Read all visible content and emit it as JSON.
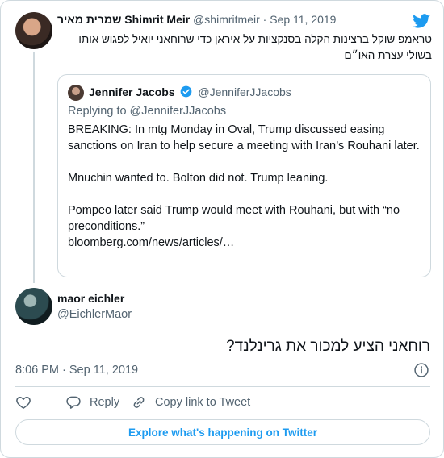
{
  "colors": {
    "brand": "#1d9bf0",
    "muted": "#536471",
    "text": "#0f1419",
    "border": "#cfd9de"
  },
  "original_tweet": {
    "author_name": "שמרית מאיר Shimrit Meir",
    "handle": "@shimritmeir",
    "date": "Sep 11, 2019",
    "text": "טראמפ שוקל ברצינות הקלה בסנקציות על איראן כדי שרוחאני יואיל לפגוש אותו בשולי עצרת האו״ם"
  },
  "quoted_tweet": {
    "author_name": "Jennifer Jacobs",
    "verified": true,
    "handle": "@JenniferJJacobs",
    "replying_to": "Replying to @JenniferJJacobs",
    "paragraphs": [
      "BREAKING: In mtg Monday in Oval, Trump discussed easing sanctions on Iran to help secure a meeting with Iran’s Rouhani later.",
      "Mnuchin wanted to. Bolton did not. Trump leaning.",
      "Pompeo later said Trump would meet with Rouhani, but with “no preconditions.”",
      "bloomberg.com/news/articles/…"
    ]
  },
  "reply_tweet": {
    "author_name": "maor eichler",
    "handle": "@EichlerMaor",
    "text": "רוחאני הציע למכור את גרינלנד?",
    "timestamp": "8:06 PM · Sep 11, 2019"
  },
  "actions": {
    "like_icon": "heart-icon",
    "reply_label": "Reply",
    "reply_icon": "speech-bubble-icon",
    "copy_link_label": "Copy link to Tweet",
    "copy_link_icon": "link-icon"
  },
  "footer": {
    "explore_label": "Explore what's happening on Twitter"
  }
}
